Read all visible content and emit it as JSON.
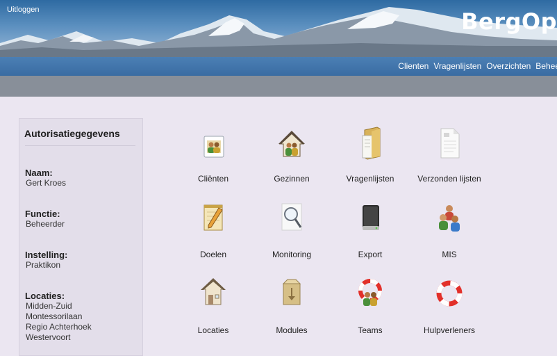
{
  "header": {
    "logout_label": "Uitloggen",
    "brand": "BergOp"
  },
  "nav": {
    "items": [
      "Clienten",
      "Vragenlijsten",
      "Overzichten",
      "Behee"
    ]
  },
  "sidebar": {
    "title": "Autorisatiegegevens",
    "name_label": "Naam:",
    "name_value": "Gert Kroes",
    "function_label": "Functie:",
    "function_value": "Beheerder",
    "institution_label": "Instelling:",
    "institution_value": "Praktikon",
    "locations_label": "Locaties:",
    "locations": [
      "Midden-Zuid",
      "Montessorilaan",
      "Regio Achterhoek",
      "Westervoort"
    ]
  },
  "modules": [
    {
      "label": "Cliënten",
      "icon": "client-card-icon"
    },
    {
      "label": "Gezinnen",
      "icon": "family-house-icon"
    },
    {
      "label": "Vragenlijsten",
      "icon": "folder-icon"
    },
    {
      "label": "Verzonden lijsten",
      "icon": "document-icon"
    },
    {
      "label": "Doelen",
      "icon": "notepad-pencil-icon"
    },
    {
      "label": "Monitoring",
      "icon": "magnifier-icon"
    },
    {
      "label": "Export",
      "icon": "hard-drive-icon"
    },
    {
      "label": "MIS",
      "icon": "users-group-icon"
    },
    {
      "label": "Locaties",
      "icon": "house-icon"
    },
    {
      "label": "Modules",
      "icon": "package-icon"
    },
    {
      "label": "Teams",
      "icon": "team-lifebuoy-icon"
    },
    {
      "label": "Hulpverleners",
      "icon": "lifebuoy-icon"
    }
  ],
  "colors": {
    "nav_bar": "#3f72a8",
    "sub_bar": "#888f99",
    "page_background": "#ebe6f1",
    "sidebar_background": "#e3deea"
  }
}
